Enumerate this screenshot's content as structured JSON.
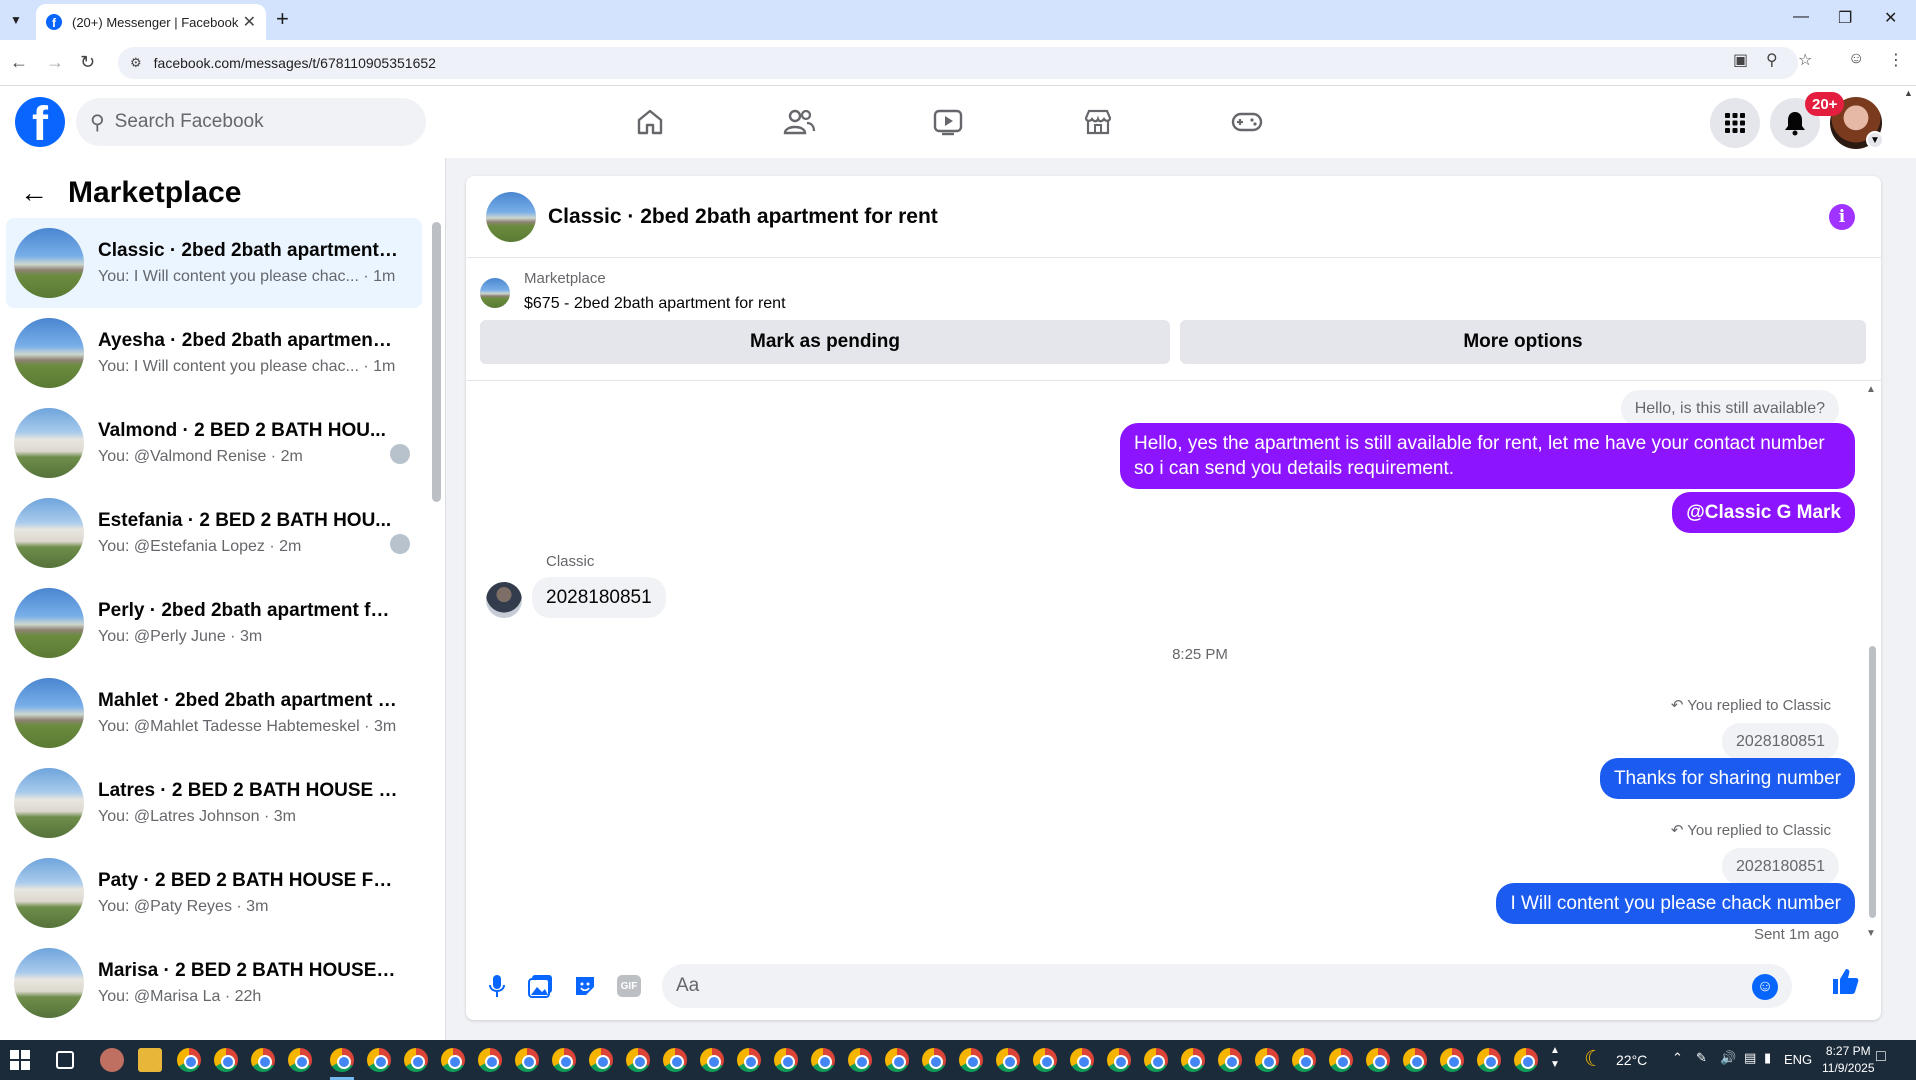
{
  "browser": {
    "tab_title": "(20+) Messenger | Facebook",
    "url": "facebook.com/messages/t/678110905351652"
  },
  "header": {
    "search_placeholder": "Search Facebook",
    "notif_badge": "20+"
  },
  "sidebar": {
    "title": "Marketplace",
    "conversations": [
      {
        "name": "Classic · 2bed 2bath apartment f...",
        "preview": "You: I Will content you please chac... · 1m",
        "thumb": "apt",
        "active": true
      },
      {
        "name": "Ayesha · 2bed 2bath apartment f...",
        "preview": "You: I Will content you please chac... · 1m",
        "thumb": "apt"
      },
      {
        "name": "Valmond · 2 BED 2 BATH HOU...",
        "preview": "You: @Valmond Renise · 2m",
        "thumb": "house"
      },
      {
        "name": "Estefania · 2 BED 2 BATH HOU...",
        "preview": "You: @Estefania Lopez · 2m",
        "thumb": "house"
      },
      {
        "name": "Perly · 2bed 2bath apartment for...",
        "preview": "You: @Perly June · 3m",
        "thumb": "apt"
      },
      {
        "name": "Mahlet · 2bed 2bath apartment f...",
        "preview": "You: @Mahlet Tadesse Habtemeskel · 3m",
        "thumb": "apt"
      },
      {
        "name": "Latres · 2 BED 2 BATH HOUSE FO...",
        "preview": "You: @Latres Johnson · 3m",
        "thumb": "house"
      },
      {
        "name": "Paty · 2 BED 2 BATH HOUSE FOR...",
        "preview": "You: @Paty Reyes · 3m",
        "thumb": "house"
      },
      {
        "name": "Marisa · 2 BED 2 BATH HOUSE F...",
        "preview": "You: @Marisa La · 22h",
        "thumb": "house"
      }
    ]
  },
  "chat": {
    "title": "Classic · 2bed 2bath apartment for rent",
    "marketplace_label": "Marketplace",
    "listing": "$675 - 2bed 2bath apartment for rent",
    "mark_pending": "Mark as pending",
    "more_options": "More options",
    "quoted_top": "Hello, is this still available?",
    "msg_reply": "Hello, yes the apartment is still available for rent, let me have your contact number so i can send you details requirement.",
    "msg_mention": "@Classic G Mark",
    "sender_name": "Classic",
    "msg_number": "2028180851",
    "time_divider": "8:25 PM",
    "replied_label_1": "You replied to Classic",
    "quoted_1": "2028180851",
    "msg_thanks": "Thanks for sharing number",
    "replied_label_2": "You replied to Classic",
    "quoted_2": "2028180851",
    "msg_last": "I Will content you please chack number",
    "sent_status": "Sent 1m ago",
    "composer_placeholder": "Aa"
  },
  "taskbar": {
    "weather": "22°C",
    "lang": "ENG",
    "time": "8:27 PM",
    "date": "11/9/2025"
  }
}
